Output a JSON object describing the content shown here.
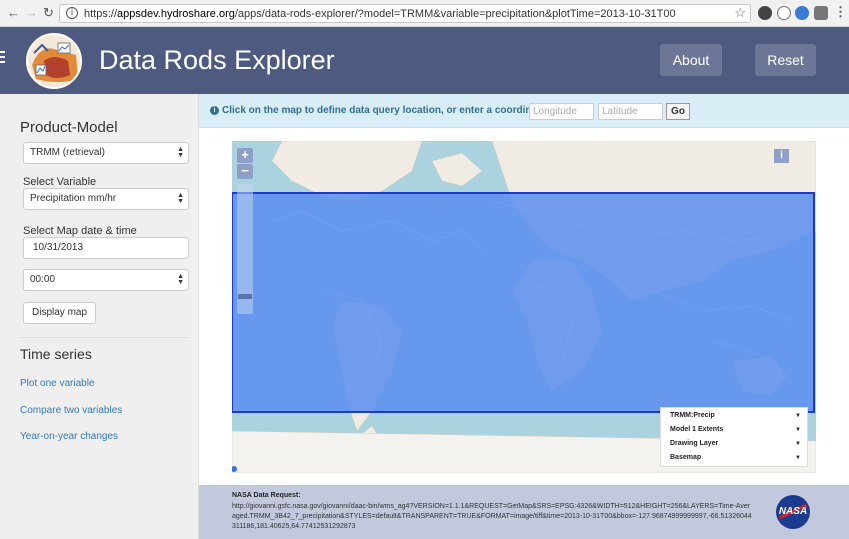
{
  "browser": {
    "url_prefix": "https://",
    "url_host": "appsdev.hydroshare.org",
    "url_path": "/apps/data-rods-explorer/?model=TRMM&variable=precipitation&plotTime=2013-10-31T00"
  },
  "header": {
    "title": "Data Rods Explorer",
    "about_label": "About",
    "reset_label": "Reset"
  },
  "sidebar": {
    "product_model_heading": "Product-Model",
    "product_model_value": "TRMM (retrieval)",
    "variable_label": "Select Variable",
    "variable_value": "Precipitation mm/hr",
    "date_label": "Select Map date & time",
    "date_value": "10/31/2013",
    "time_value": "00:00",
    "display_map_label": "Display map",
    "time_series_heading": "Time series",
    "links": [
      "Plot one variable",
      "Compare two variables",
      "Year-on-year changes"
    ]
  },
  "infobar": {
    "message": "Click on the map to define data query location, or enter a coordinate:",
    "longitude_placeholder": "Longitude",
    "latitude_placeholder": "Latitude",
    "go_label": "Go"
  },
  "map": {
    "zoom_in": "+",
    "zoom_out": "−",
    "info_label": "i",
    "layers": [
      "TRMM:Precip",
      "Model 1 Extents",
      "Drawing Layer",
      "Basemap"
    ]
  },
  "footer": {
    "title": "NASA Data Request:",
    "url": "http://giovanni.gsfc.nasa.gov/giovanni/daac-bin/wms_ag4?VERSION=1.1.1&REQUEST=GetMap&SRS=EPSG:4326&WIDTH=512&HEIGHT=256&LAYERS=Time-Averaged.TRMM_3B42_7_precipitation&STYLES=default&TRANSPARENT=TRUE&FORMAT=image/tiff&time=2013-10-31T00&bbox=-127.96874999999997,-66.51326044311186,181.40625,64.77412531292873",
    "logo_text": "NASA"
  },
  "colors": {
    "header": "#4e5a7f",
    "overlay": "#5b8ef0",
    "footer": "#c3c9dc"
  }
}
